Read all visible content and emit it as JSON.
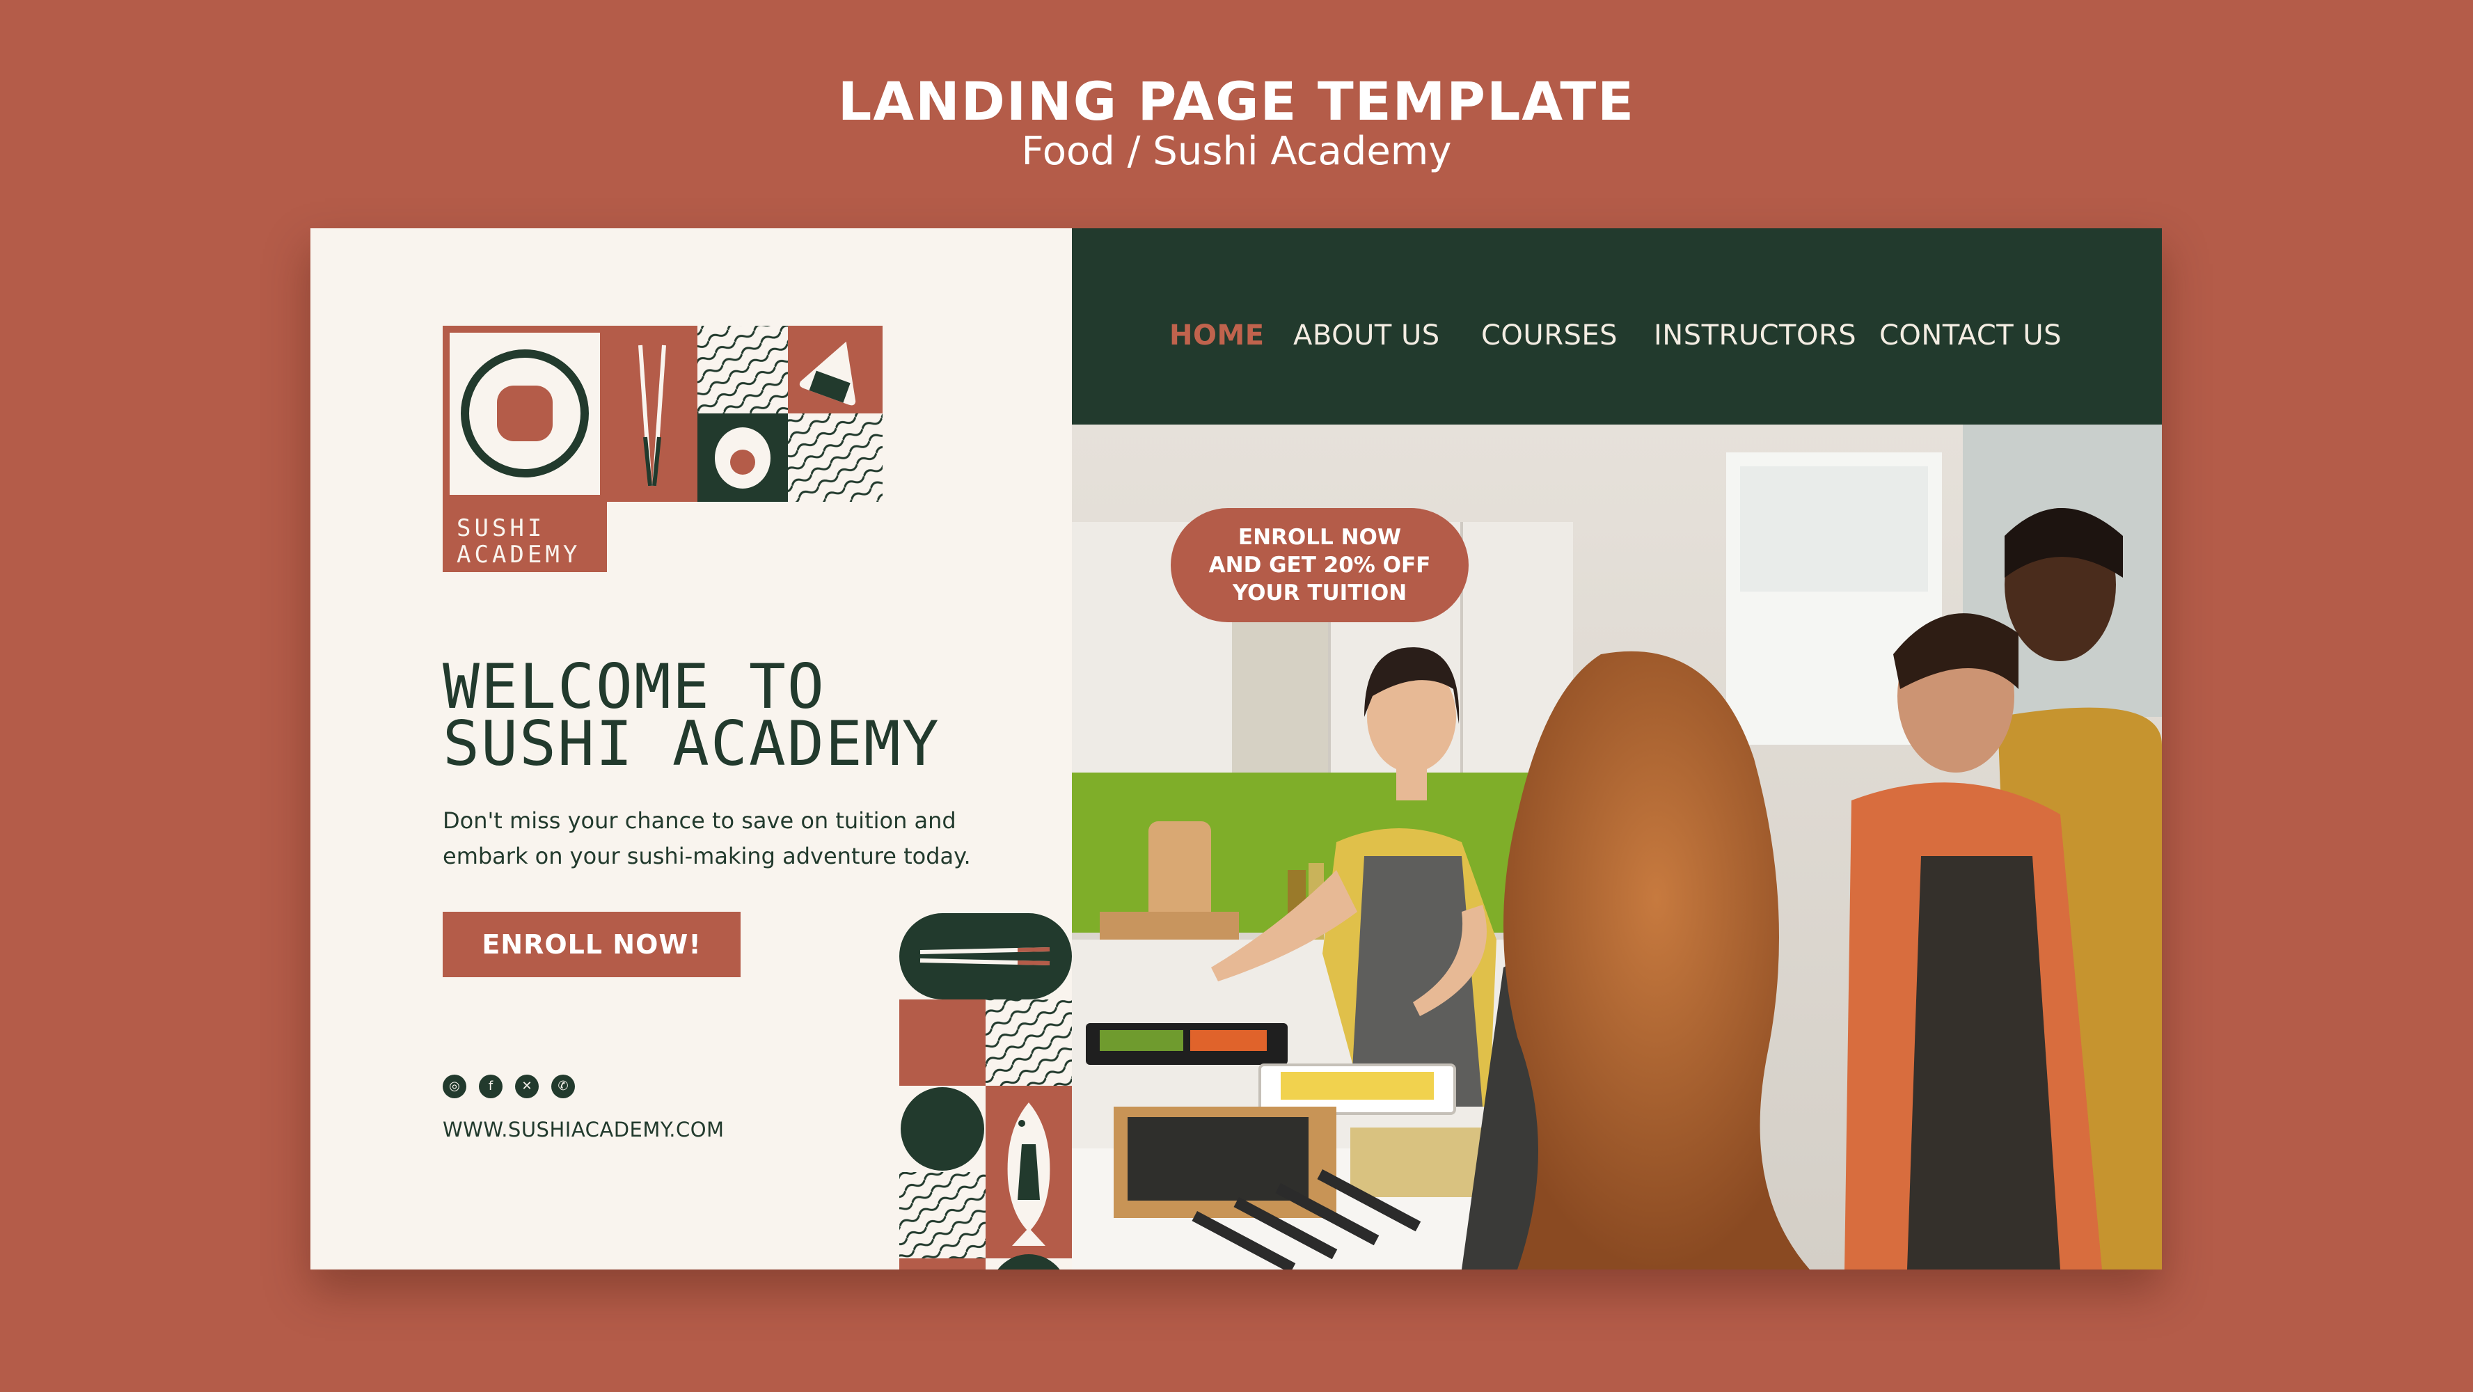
{
  "header": {
    "title": "LANDING PAGE TEMPLATE",
    "subtitle": "Food / Sushi Academy"
  },
  "logo": {
    "line1": "SUSHI",
    "line2": "ACADEMY"
  },
  "nav": {
    "items": [
      {
        "label": "HOME",
        "active": true
      },
      {
        "label": "ABOUT US",
        "active": false
      },
      {
        "label": "COURSES",
        "active": false
      },
      {
        "label": "INSTRUCTORS",
        "active": false
      },
      {
        "label": "CONTACT US",
        "active": false
      }
    ]
  },
  "promo": {
    "line1": "ENROLL NOW",
    "line2": "AND GET 20% OFF",
    "line3": "YOUR TUITION"
  },
  "hero": {
    "title_line1": "WELCOME TO",
    "title_line2": "SUSHI ACADEMY",
    "desc_line1": "Don't miss your chance to save on tuition and",
    "desc_line2": "embark on your sushi-making adventure today.",
    "cta_label": "ENROLL NOW!"
  },
  "social": {
    "icons": [
      "instagram-icon",
      "facebook-icon",
      "x-icon",
      "whatsapp-icon"
    ],
    "website": "WWW.SUSHIACADEMY.COM"
  },
  "colors": {
    "background": "#b45c49",
    "accent": "#b45c49",
    "dark_green": "#223a2d",
    "cream": "#f9f4ee"
  }
}
